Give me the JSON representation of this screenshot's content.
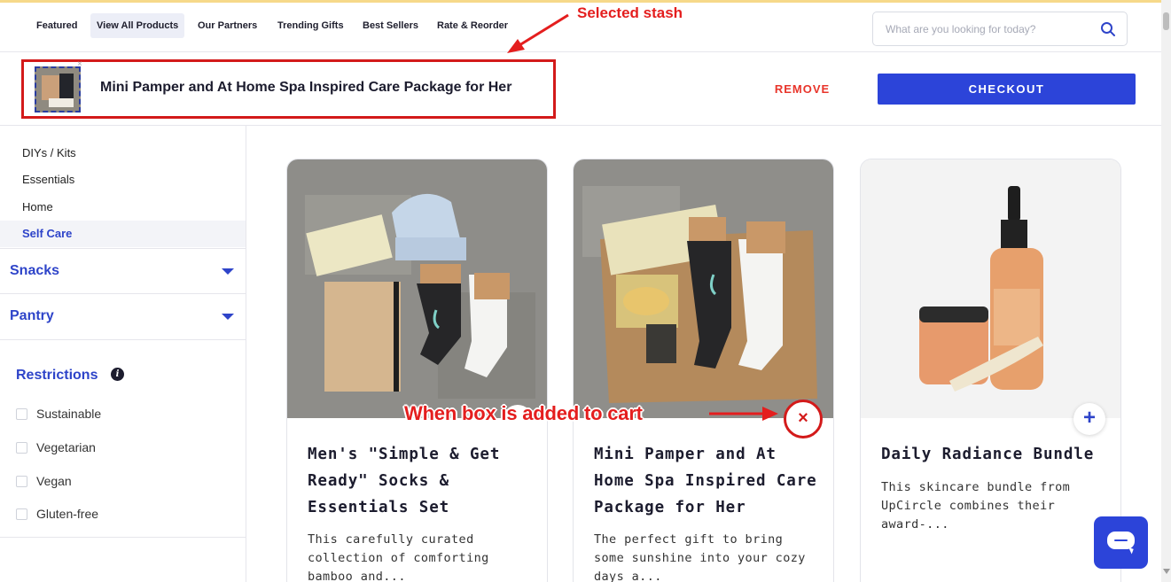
{
  "nav": {
    "items": [
      {
        "label": "Featured",
        "active": false
      },
      {
        "label": "View All Products",
        "active": true
      },
      {
        "label": "Our Partners",
        "active": false
      },
      {
        "label": "Trending Gifts",
        "active": false
      },
      {
        "label": "Best Sellers",
        "active": false
      },
      {
        "label": "Rate & Reorder",
        "active": false
      }
    ],
    "search_placeholder": "What are you looking for today?",
    "search_icon": "search-icon"
  },
  "stash": {
    "title": "Mini Pamper and At Home Spa Inspired Care Package for Her",
    "remove_label": "REMOVE",
    "checkout_label": "CHECKOUT",
    "thumb_close": "×"
  },
  "sidebar": {
    "sub_items": [
      {
        "label": "DIYs / Kits",
        "active": false
      },
      {
        "label": "Essentials",
        "active": false
      },
      {
        "label": "Home",
        "active": false
      },
      {
        "label": "Self Care",
        "active": true
      }
    ],
    "categories": [
      {
        "label": "Snacks",
        "icon": "caret-down-icon"
      },
      {
        "label": "Pantry",
        "icon": "caret-down-icon"
      }
    ],
    "restrictions": {
      "title": "Restrictions",
      "info_icon": "i",
      "options": [
        {
          "label": "Sustainable",
          "checked": false
        },
        {
          "label": "Vegetarian",
          "checked": false
        },
        {
          "label": "Vegan",
          "checked": false
        },
        {
          "label": "Gluten-free",
          "checked": false
        }
      ]
    }
  },
  "products": [
    {
      "title": "Men's \"Simple & Get Ready\" Socks & Essentials Set",
      "description": "This carefully curated collection of comforting bamboo and...",
      "action": "none"
    },
    {
      "title": "Mini Pamper and At Home Spa Inspired Care Package for Her",
      "description": "The perfect gift to bring some sunshine into your cozy days a...",
      "action": "remove",
      "action_symbol": "×"
    },
    {
      "title": "Daily Radiance Bundle",
      "description": "This skincare bundle from UpCircle combines their award-...",
      "action": "add",
      "action_symbol": "+"
    }
  ],
  "annotations": {
    "selected_stash": "Selected stash",
    "cart_note": "When box is added to cart",
    "color": "#e41e1e"
  },
  "colors": {
    "accent": "#2c44d9",
    "link_blue": "#2e44c9",
    "remove_red": "#e8352b"
  }
}
